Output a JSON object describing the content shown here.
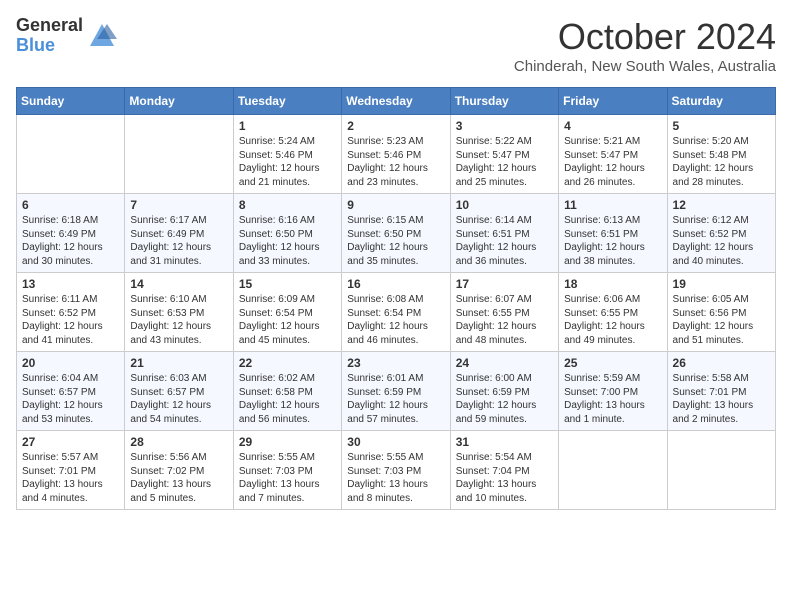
{
  "header": {
    "logo": {
      "general": "General",
      "blue": "Blue"
    },
    "title": "October 2024",
    "subtitle": "Chinderah, New South Wales, Australia"
  },
  "calendar": {
    "days_of_week": [
      "Sunday",
      "Monday",
      "Tuesday",
      "Wednesday",
      "Thursday",
      "Friday",
      "Saturday"
    ],
    "weeks": [
      [
        {
          "day": "",
          "info": ""
        },
        {
          "day": "",
          "info": ""
        },
        {
          "day": "1",
          "info": "Sunrise: 5:24 AM\nSunset: 5:46 PM\nDaylight: 12 hours\nand 21 minutes."
        },
        {
          "day": "2",
          "info": "Sunrise: 5:23 AM\nSunset: 5:46 PM\nDaylight: 12 hours\nand 23 minutes."
        },
        {
          "day": "3",
          "info": "Sunrise: 5:22 AM\nSunset: 5:47 PM\nDaylight: 12 hours\nand 25 minutes."
        },
        {
          "day": "4",
          "info": "Sunrise: 5:21 AM\nSunset: 5:47 PM\nDaylight: 12 hours\nand 26 minutes."
        },
        {
          "day": "5",
          "info": "Sunrise: 5:20 AM\nSunset: 5:48 PM\nDaylight: 12 hours\nand 28 minutes."
        }
      ],
      [
        {
          "day": "6",
          "info": "Sunrise: 6:18 AM\nSunset: 6:49 PM\nDaylight: 12 hours\nand 30 minutes."
        },
        {
          "day": "7",
          "info": "Sunrise: 6:17 AM\nSunset: 6:49 PM\nDaylight: 12 hours\nand 31 minutes."
        },
        {
          "day": "8",
          "info": "Sunrise: 6:16 AM\nSunset: 6:50 PM\nDaylight: 12 hours\nand 33 minutes."
        },
        {
          "day": "9",
          "info": "Sunrise: 6:15 AM\nSunset: 6:50 PM\nDaylight: 12 hours\nand 35 minutes."
        },
        {
          "day": "10",
          "info": "Sunrise: 6:14 AM\nSunset: 6:51 PM\nDaylight: 12 hours\nand 36 minutes."
        },
        {
          "day": "11",
          "info": "Sunrise: 6:13 AM\nSunset: 6:51 PM\nDaylight: 12 hours\nand 38 minutes."
        },
        {
          "day": "12",
          "info": "Sunrise: 6:12 AM\nSunset: 6:52 PM\nDaylight: 12 hours\nand 40 minutes."
        }
      ],
      [
        {
          "day": "13",
          "info": "Sunrise: 6:11 AM\nSunset: 6:52 PM\nDaylight: 12 hours\nand 41 minutes."
        },
        {
          "day": "14",
          "info": "Sunrise: 6:10 AM\nSunset: 6:53 PM\nDaylight: 12 hours\nand 43 minutes."
        },
        {
          "day": "15",
          "info": "Sunrise: 6:09 AM\nSunset: 6:54 PM\nDaylight: 12 hours\nand 45 minutes."
        },
        {
          "day": "16",
          "info": "Sunrise: 6:08 AM\nSunset: 6:54 PM\nDaylight: 12 hours\nand 46 minutes."
        },
        {
          "day": "17",
          "info": "Sunrise: 6:07 AM\nSunset: 6:55 PM\nDaylight: 12 hours\nand 48 minutes."
        },
        {
          "day": "18",
          "info": "Sunrise: 6:06 AM\nSunset: 6:55 PM\nDaylight: 12 hours\nand 49 minutes."
        },
        {
          "day": "19",
          "info": "Sunrise: 6:05 AM\nSunset: 6:56 PM\nDaylight: 12 hours\nand 51 minutes."
        }
      ],
      [
        {
          "day": "20",
          "info": "Sunrise: 6:04 AM\nSunset: 6:57 PM\nDaylight: 12 hours\nand 53 minutes."
        },
        {
          "day": "21",
          "info": "Sunrise: 6:03 AM\nSunset: 6:57 PM\nDaylight: 12 hours\nand 54 minutes."
        },
        {
          "day": "22",
          "info": "Sunrise: 6:02 AM\nSunset: 6:58 PM\nDaylight: 12 hours\nand 56 minutes."
        },
        {
          "day": "23",
          "info": "Sunrise: 6:01 AM\nSunset: 6:59 PM\nDaylight: 12 hours\nand 57 minutes."
        },
        {
          "day": "24",
          "info": "Sunrise: 6:00 AM\nSunset: 6:59 PM\nDaylight: 12 hours\nand 59 minutes."
        },
        {
          "day": "25",
          "info": "Sunrise: 5:59 AM\nSunset: 7:00 PM\nDaylight: 13 hours\nand 1 minute."
        },
        {
          "day": "26",
          "info": "Sunrise: 5:58 AM\nSunset: 7:01 PM\nDaylight: 13 hours\nand 2 minutes."
        }
      ],
      [
        {
          "day": "27",
          "info": "Sunrise: 5:57 AM\nSunset: 7:01 PM\nDaylight: 13 hours\nand 4 minutes."
        },
        {
          "day": "28",
          "info": "Sunrise: 5:56 AM\nSunset: 7:02 PM\nDaylight: 13 hours\nand 5 minutes."
        },
        {
          "day": "29",
          "info": "Sunrise: 5:55 AM\nSunset: 7:03 PM\nDaylight: 13 hours\nand 7 minutes."
        },
        {
          "day": "30",
          "info": "Sunrise: 5:55 AM\nSunset: 7:03 PM\nDaylight: 13 hours\nand 8 minutes."
        },
        {
          "day": "31",
          "info": "Sunrise: 5:54 AM\nSunset: 7:04 PM\nDaylight: 13 hours\nand 10 minutes."
        },
        {
          "day": "",
          "info": ""
        },
        {
          "day": "",
          "info": ""
        }
      ]
    ]
  }
}
